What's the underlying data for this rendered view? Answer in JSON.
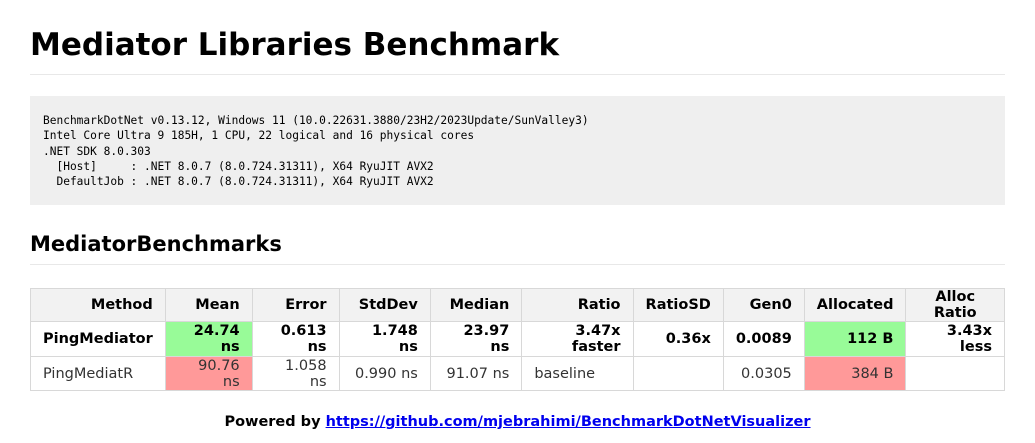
{
  "title": "Mediator Libraries Benchmark",
  "env_lines": [
    "BenchmarkDotNet v0.13.12, Windows 11 (10.0.22631.3880/23H2/2023Update/SunValley3)",
    "Intel Core Ultra 9 185H, 1 CPU, 22 logical and 16 physical cores",
    ".NET SDK 8.0.303",
    "  [Host]     : .NET 8.0.7 (8.0.724.31311), X64 RyuJIT AVX2",
    "  DefaultJob : .NET 8.0.7 (8.0.724.31311), X64 RyuJIT AVX2"
  ],
  "section_title": "MediatorBenchmarks",
  "table": {
    "headers": [
      "Method",
      "Mean",
      "Error",
      "StdDev",
      "Median",
      "Ratio",
      "RatioSD",
      "Gen0",
      "Allocated",
      "Alloc Ratio"
    ],
    "rows": [
      [
        "PingMediator",
        "24.74 ns",
        "0.613 ns",
        "1.748 ns",
        "23.97 ns",
        "3.47x faster",
        "0.36x",
        "0.0089",
        "112 B",
        "3.43x less"
      ],
      [
        "PingMediatR",
        "90.76 ns",
        "1.058 ns",
        "0.990 ns",
        "91.07 ns",
        "baseline",
        "",
        "0.0305",
        "384 B",
        ""
      ]
    ]
  },
  "colors": {
    "best": "#98fb98",
    "worst": "#ff9999"
  },
  "footer": {
    "prefix": "Powered by",
    "link": "https://github.com/mjebrahimi/BenchmarkDotNetVisualizer"
  }
}
